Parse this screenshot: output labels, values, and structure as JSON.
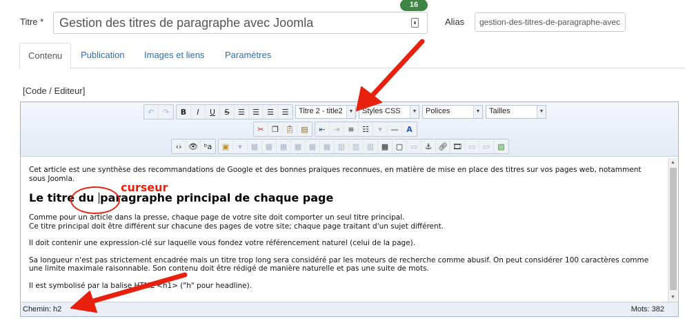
{
  "title_field": {
    "label": "Titre *",
    "value": "Gestion des titres de paragraphe avec Joomla",
    "char_count": "16"
  },
  "alias_field": {
    "label": "Alias",
    "value": "gestion-des-titres-de-paragraphe-avec"
  },
  "tabs": [
    {
      "label": "Contenu"
    },
    {
      "label": "Publication"
    },
    {
      "label": "Images et liens"
    },
    {
      "label": "Paramètres"
    }
  ],
  "code_toggle": "[Code / Editeur]",
  "toolbar": {
    "format_select": "Titre 2 - title2",
    "styles_select": "Styles CSS",
    "fonts_select": "Polices",
    "sizes_select": "Tailles"
  },
  "content": {
    "intro": "Cet article est une synthèse des recommandations de Google et des bonnes praiques reconnues, en matière de mise en place des titres sur vos pages web, notamment sous Joomla.",
    "heading_before": "Le titre du ",
    "heading_after": "paragraphe principal de chaque page",
    "p1_line1": "Comme pour un article dans la presse, chaque page de votre site doit comporter un seul titre principal.",
    "p1_line2": "Ce titre principal doit être différent sur chacune des pages de votre site; chaque page traitant d'un sujet différent.",
    "p2": "Il doit contenir une expression-clé sur laquelle vous fondez votre référencement naturel (celui de la page).",
    "p3": "Sa longueur n'est pas strictement encadrée mais un titre trop long sera considéré par les moteurs de recherche comme abusif. On peut considérer 100 caractères comme une limite maximale raisonnable. Son contenu doit être rédigé de manière naturelle et pas une suite de mots.",
    "p4": "Il est symbolisé par la balise HTML <h1> (\"h\" pour headline)."
  },
  "statusbar": {
    "path": "Chemin: h2",
    "words": "Mots: 382"
  },
  "annotation": {
    "label": "curseur",
    "color": "#e8210f"
  }
}
